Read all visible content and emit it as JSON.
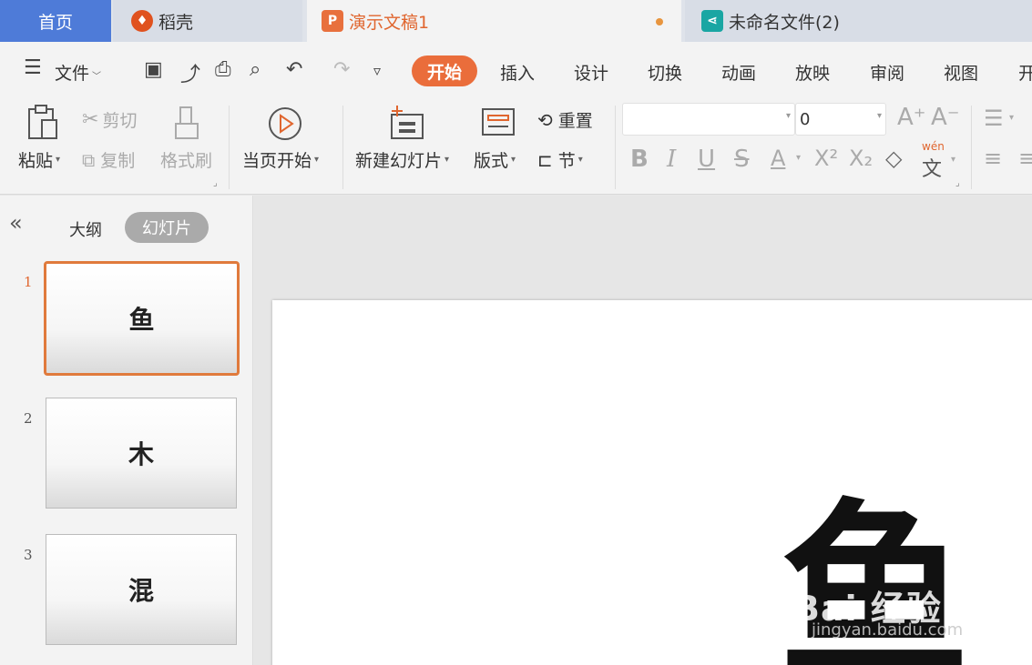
{
  "tabs": {
    "home": "首页",
    "daoke": "稻壳",
    "doc": "演示文稿1",
    "file": "未命名文件(2)"
  },
  "menu": {
    "file_label": "文件",
    "items": [
      "开始",
      "插入",
      "设计",
      "切换",
      "动画",
      "放映",
      "审阅",
      "视图",
      "开"
    ]
  },
  "ribbon": {
    "paste": "粘贴",
    "cut": "剪切",
    "copy": "复制",
    "format_painter": "格式刷",
    "from_current": "当页开始",
    "new_slide": "新建幻灯片",
    "layout": "版式",
    "reset": "重置",
    "section": "节",
    "font_size": "0",
    "wen": "wén",
    "wen_char": "文"
  },
  "panel": {
    "outline": "大纲",
    "slides": "幻灯片",
    "thumbnails": [
      {
        "num": "1",
        "text": "鱼"
      },
      {
        "num": "2",
        "text": "木"
      },
      {
        "num": "3",
        "text": "混"
      }
    ]
  },
  "slide": {
    "main_char": "鱼",
    "watermark": "Bai 经验",
    "watermark_url": "jingyan.baidu.com"
  },
  "colors": {
    "accent": "#ea6d3b",
    "home_tab": "#4e7bd8"
  }
}
